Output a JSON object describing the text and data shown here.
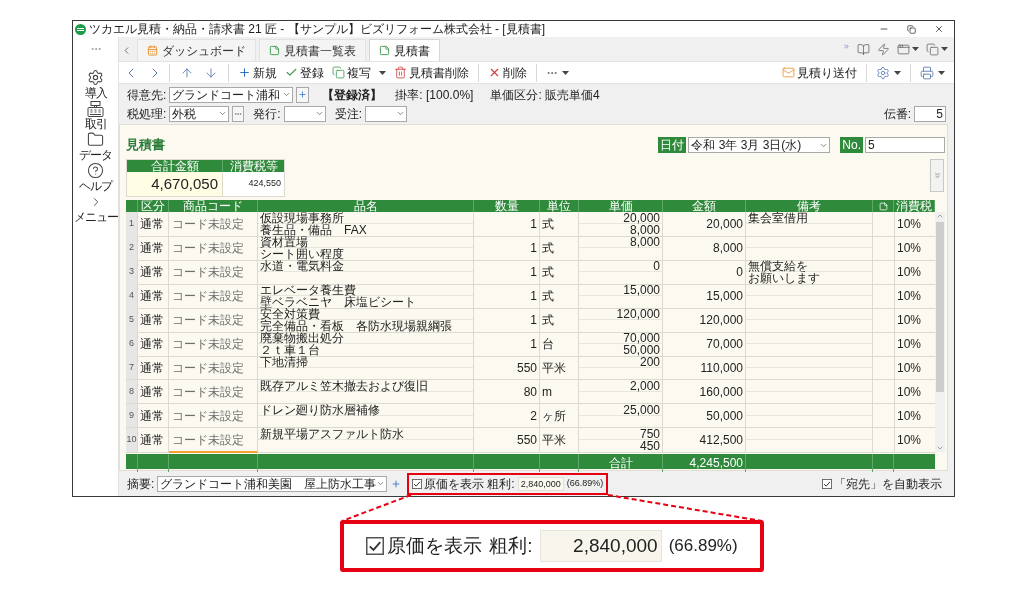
{
  "window": {
    "title": "ツカエル見積・納品・請求書 21 匠 - 【サンプル】ビズリフォーム株式会社 - [見積書]"
  },
  "sidebar": {
    "items": [
      {
        "label": "導入"
      },
      {
        "label": "取引"
      },
      {
        "label": "データ"
      },
      {
        "label": "ヘルプ"
      },
      {
        "label": "メニュー"
      }
    ]
  },
  "tabs": [
    {
      "label": "ダッシュボード",
      "selected": false
    },
    {
      "label": "見積書一覧表",
      "selected": false
    },
    {
      "label": "見積書",
      "selected": true
    }
  ],
  "toolbar": {
    "buttons": [
      {
        "label": "新規",
        "kind": "button"
      },
      {
        "label": "登録",
        "kind": "button"
      },
      {
        "label": "複写",
        "kind": "split"
      },
      {
        "label": "見積書削除",
        "kind": "button"
      },
      {
        "label": "削除",
        "kind": "button"
      }
    ],
    "send": "見積り送付"
  },
  "form": {
    "customer": {
      "label": "得意先:",
      "value": "グランドコート浦和"
    },
    "status": "【登録済】",
    "rate": "掛率: [100.0%]",
    "price_class": "単価区分: 販売単価4",
    "tax_mode": {
      "label": "税処理:",
      "value": "外税"
    },
    "issue": {
      "label": "発行:"
    },
    "order": {
      "label": "受注:"
    },
    "slip": {
      "label": "伝番:",
      "value": "5"
    }
  },
  "document": {
    "title": "見積書",
    "date": {
      "label": "日付",
      "value": "令和 3年 3月 3日(水)"
    },
    "number": {
      "label": "No.",
      "value": "5"
    },
    "totals": {
      "total_label": "合計金額",
      "total": "4,670,050",
      "tax_label": "消費税等",
      "tax": "424,550"
    }
  },
  "table": {
    "columns": [
      "区分",
      "商品コード",
      "品名",
      "数量",
      "単位",
      "単価",
      "金額",
      "備考",
      "消費税"
    ],
    "rows": [
      {
        "number": "1",
        "category": "通常",
        "code": "コード未設定",
        "focused": false,
        "name": "仮設現場事務所",
        "name_2": "養生品・備品　FAX",
        "quantity": "1",
        "unit": "式",
        "unit_price": "20,000",
        "cost": "8,000",
        "amount": "20,000",
        "note": "集会室借用",
        "tax": "10%"
      },
      {
        "number": "2",
        "category": "通常",
        "code": "コード未設定",
        "focused": false,
        "name": "資材置場",
        "name_2": "シート囲い程度",
        "quantity": "1",
        "unit": "式",
        "unit_price": "8,000",
        "amount": "8,000",
        "tax": "10%"
      },
      {
        "number": "3",
        "category": "通常",
        "code": "コード未設定",
        "focused": false,
        "name": "水道・電気料金",
        "quantity": "1",
        "unit": "式",
        "unit_price": "0",
        "amount": "0",
        "note": "無償支給を",
        "note_2": "お願いします",
        "tax": "10%"
      },
      {
        "number": "4",
        "category": "通常",
        "code": "コード未設定",
        "focused": false,
        "name": "エレベータ養生費",
        "name_2": "壁ベラベニヤ　床塩ビシート",
        "quantity": "1",
        "unit": "式",
        "unit_price": "15,000",
        "amount": "15,000",
        "tax": "10%"
      },
      {
        "number": "5",
        "category": "通常",
        "code": "コード未設定",
        "focused": false,
        "name": "安全対策費",
        "name_2": "完全備品・看板　各防水現場親綱張",
        "quantity": "1",
        "unit": "式",
        "unit_price": "120,000",
        "amount": "120,000",
        "tax": "10%"
      },
      {
        "number": "6",
        "category": "通常",
        "code": "コード未設定",
        "focused": false,
        "name": "廃棄物搬出処分",
        "name_2": "２ｔ車１台",
        "quantity": "1",
        "unit": "台",
        "unit_price": "70,000",
        "cost": "50,000",
        "amount": "70,000",
        "tax": "10%"
      },
      {
        "number": "7",
        "category": "通常",
        "code": "コード未設定",
        "focused": false,
        "name": "下地清掃",
        "quantity": "550",
        "unit": "平米",
        "unit_price": "200",
        "amount": "110,000",
        "tax": "10%"
      },
      {
        "number": "8",
        "category": "通常",
        "code": "コード未設定",
        "focused": false,
        "name": "既存アルミ笠木撤去および復旧",
        "quantity": "80",
        "unit": "m",
        "unit_price": "2,000",
        "amount": "160,000",
        "tax": "10%"
      },
      {
        "number": "9",
        "category": "通常",
        "code": "コード未設定",
        "focused": false,
        "name": "ドレン廻り防水層補修",
        "quantity": "2",
        "unit": "ヶ所",
        "unit_price": "25,000",
        "amount": "50,000",
        "tax": "10%"
      },
      {
        "number": "10",
        "category": "通常",
        "code": "コード未設定",
        "focused": true,
        "name": "新規平場アスファルト防水",
        "quantity": "550",
        "unit": "平米",
        "unit_price": "750",
        "cost": "450",
        "amount": "412,500",
        "tax": "10%"
      }
    ],
    "footer": {
      "label": "合計",
      "total": "4,245,500"
    }
  },
  "bottom": {
    "summary": {
      "label": "摘要:",
      "value": "グランドコート浦和美園　屋上防水工事"
    },
    "show_cost": {
      "label": "原価を表示",
      "checked": true
    },
    "profit": {
      "label": "粗利:",
      "value": "2,840,000",
      "rate": "(66.89%)"
    },
    "auto_address": {
      "label": "「宛先」を自動表示",
      "checked": true
    }
  },
  "callout": {
    "show_cost": {
      "label": "原価を表示",
      "checked": true
    },
    "profit": {
      "label": "粗利:",
      "value": "2,840,000",
      "rate": "(66.89%)"
    }
  }
}
